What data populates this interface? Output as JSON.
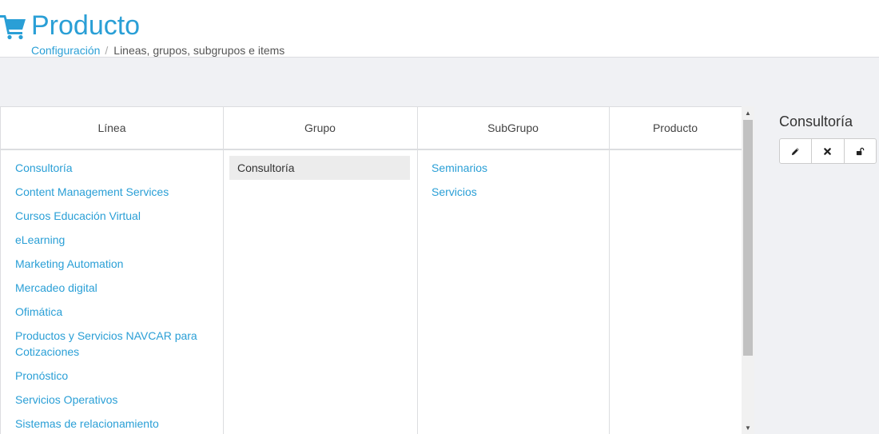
{
  "header": {
    "title": "Producto",
    "icon": "shopping-cart-icon",
    "accent_color": "#2a9fd6"
  },
  "breadcrumb": {
    "link": "Configuración",
    "separator": "/",
    "current": "Lineas, grupos, subgrupos e items"
  },
  "columns": {
    "linea": {
      "header": "Línea",
      "items": [
        "Consultoría",
        "Content Management Services",
        "Cursos Educación Virtual",
        "eLearning",
        "Marketing Automation",
        "Mercadeo digital",
        "Ofimática",
        "Productos y Servicios NAVCAR para Cotizaciones",
        "Pronóstico",
        "Servicios Operativos",
        "Sistemas de relacionamiento"
      ]
    },
    "grupo": {
      "header": "Grupo",
      "items": [
        "Consultoría"
      ],
      "selected_index": 0
    },
    "subgrupo": {
      "header": "SubGrupo",
      "items": [
        "Seminarios",
        "Servicios"
      ]
    },
    "producto": {
      "header": "Producto",
      "items": []
    }
  },
  "side_panel": {
    "title": "Consultoría",
    "actions": [
      {
        "name": "edit",
        "icon": "pencil-icon"
      },
      {
        "name": "delete",
        "icon": "close-icon"
      },
      {
        "name": "unlock",
        "icon": "unlock-icon"
      }
    ]
  }
}
